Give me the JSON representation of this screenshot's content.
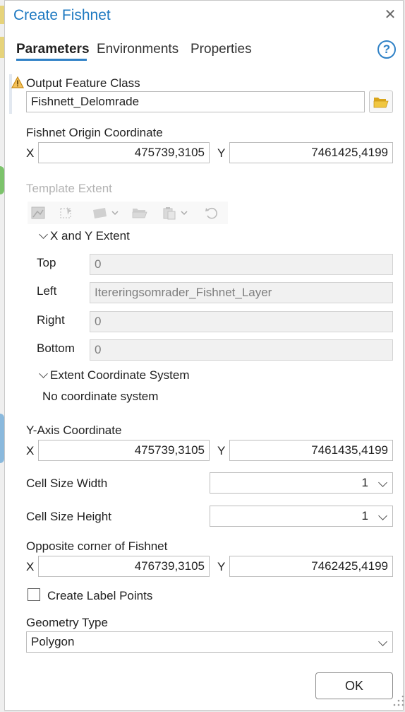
{
  "window": {
    "title": "Create Fishnet",
    "close_glyph": "✕"
  },
  "tabs": [
    {
      "label": "Parameters",
      "active": true
    },
    {
      "label": "Environments",
      "active": false
    },
    {
      "label": "Properties",
      "active": false
    }
  ],
  "help": {
    "glyph": "?"
  },
  "output_feature_class": {
    "label": "Output Feature Class",
    "value": "Fishnett_Delomrade",
    "warning_icon": "warning-triangle-icon",
    "browse_icon": "folder-open-icon"
  },
  "fishnet_origin": {
    "label": "Fishnet Origin Coordinate",
    "x_label": "X",
    "x_value": "475739,3105",
    "y_label": "Y",
    "y_value": "7461425,4199"
  },
  "template_extent": {
    "label": "Template Extent",
    "toolbar_icons": [
      "extent-map-icon",
      "draw-extent-icon",
      "layer-dropdown-icon",
      "browse-folder-icon",
      "paste-dropdown-icon",
      "reset-icon"
    ],
    "xy_extent": {
      "header": "X and Y Extent",
      "top_label": "Top",
      "top_value": "0",
      "left_label": "Left",
      "left_value": "Itereringsomrader_Fishnet_Layer",
      "right_label": "Right",
      "right_value": "0",
      "bottom_label": "Bottom",
      "bottom_value": "0"
    },
    "coord_system": {
      "header": "Extent Coordinate System",
      "value": "No coordinate system"
    }
  },
  "y_axis": {
    "label": "Y-Axis Coordinate",
    "x_label": "X",
    "x_value": "475739,3105",
    "y_label": "Y",
    "y_value": "7461435,4199"
  },
  "cell_width": {
    "label": "Cell Size Width",
    "value": "1"
  },
  "cell_height": {
    "label": "Cell Size Height",
    "value": "1"
  },
  "opposite_corner": {
    "label": "Opposite corner of Fishnet",
    "x_label": "X",
    "x_value": "476739,3105",
    "y_label": "Y",
    "y_value": "7462425,4199"
  },
  "label_points": {
    "label": "Create Label Points",
    "checked": false
  },
  "geometry_type": {
    "label": "Geometry Type",
    "value": "Polygon"
  },
  "ok_button": {
    "label": "OK"
  },
  "colors": {
    "accent": "#1e79c1",
    "tab_underline": "#2f81c6",
    "warning": "#e0a020",
    "folder": "#e8b920"
  }
}
